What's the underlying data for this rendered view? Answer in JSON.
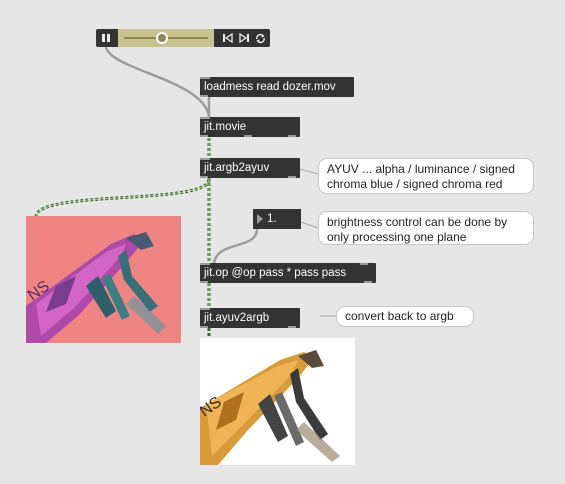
{
  "transport": {
    "pause_icon": "pause-icon",
    "step_back_icon": "step-back-icon",
    "step_forward_icon": "step-forward-icon",
    "loop_icon": "loop-icon",
    "position": 0.45
  },
  "objects": {
    "loadmess": "loadmess read dozer.mov",
    "movie": "jit.movie",
    "argb2ayuv": "jit.argb2ayuv",
    "op": "jit.op @op pass * pass pass",
    "ayuv2argb": "jit.ayuv2argb"
  },
  "number_box": {
    "value": "1."
  },
  "comments": {
    "ayuv": "AYUV ... alpha / luminance / signed chroma blue / signed chroma red",
    "brightness": "brightness control can be done by only processing one plane",
    "convert": "convert back to argb"
  },
  "colors": {
    "background": "#e6e6e6",
    "object": "#333333",
    "transport_track": "#c8c28e",
    "matrix_cord": "#2e7d32",
    "yuv_preview": "#ef8582",
    "rgb_preview": "#ffffff"
  }
}
